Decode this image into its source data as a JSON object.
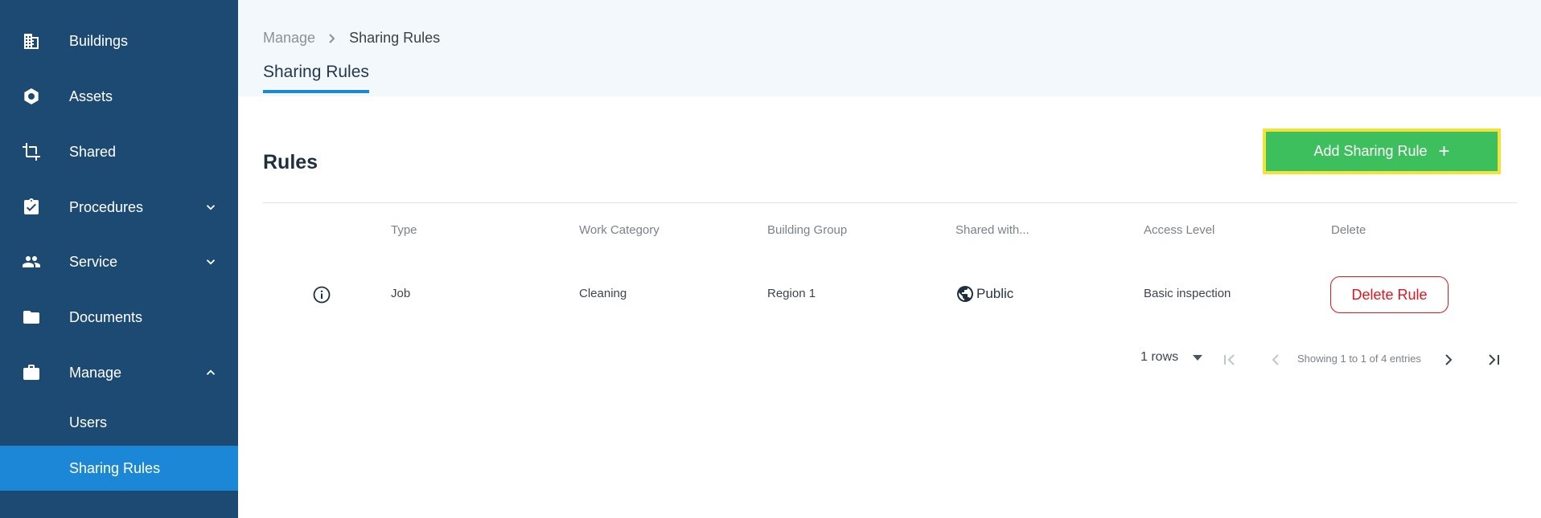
{
  "sidebar": {
    "items": [
      {
        "label": "Buildings",
        "icon": "buildings-icon"
      },
      {
        "label": "Assets",
        "icon": "hexagon-icon"
      },
      {
        "label": "Shared",
        "icon": "crop-icon"
      },
      {
        "label": "Procedures",
        "icon": "clipboard-check-icon"
      },
      {
        "label": "Service",
        "icon": "people-icon"
      },
      {
        "label": "Documents",
        "icon": "folder-icon"
      },
      {
        "label": "Manage",
        "icon": "briefcase-icon"
      }
    ],
    "sub_items": [
      {
        "label": "Users"
      },
      {
        "label": "Sharing Rules",
        "active": true
      }
    ],
    "active_color": "#1c87d6",
    "background_color": "#1d4a72"
  },
  "header": {
    "breadcrumb": {
      "parent": "Manage",
      "current": "Sharing Rules"
    },
    "tab": "Sharing Rules"
  },
  "main": {
    "section_title": "Rules",
    "add_button": {
      "label": "Add Sharing Rule",
      "icon": "plus-icon",
      "color": "#3dbf5d"
    },
    "table": {
      "columns": [
        "Type",
        "Work Category",
        "Building Group",
        "Shared with...",
        "Access Level",
        "Delete"
      ],
      "rows": [
        {
          "type": "Job",
          "work_category": "Cleaning",
          "building_group": "Region 1",
          "shared_with": "Public",
          "access_level": "Basic inspection",
          "delete_label": "Delete Rule"
        }
      ]
    },
    "pagination": {
      "rows_per_page": "1 rows",
      "info": "Showing 1 to 1 of 4 entries"
    }
  }
}
